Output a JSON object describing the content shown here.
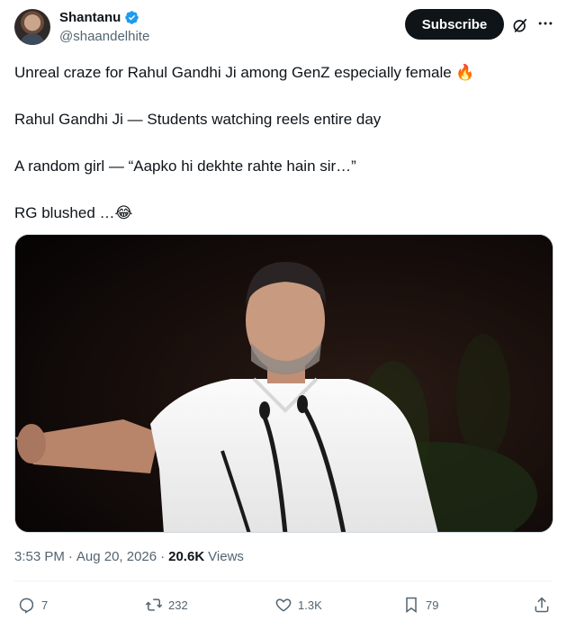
{
  "author": {
    "name": "Shantanu",
    "handle": "@shaandelhite"
  },
  "header": {
    "subscribe_label": "Subscribe"
  },
  "post": {
    "lines": [
      "Unreal craze for Rahul Gandhi Ji among GenZ especially female 🔥",
      "Rahul Gandhi Ji — Students watching reels entire day",
      "A random girl — “Aapko hi dekhte rahte hain sir…”",
      "RG blushed …😂"
    ]
  },
  "meta": {
    "time": "3:53 PM",
    "separator": "·",
    "date": "Aug 20, 2026",
    "separator2": "·",
    "views_count": "20.6K",
    "views_label": "Views"
  },
  "actions": {
    "replies": "7",
    "reposts": "232",
    "likes": "1.3K",
    "bookmarks": "79"
  },
  "icons": [
    "verified-badge-icon",
    "grok-icon",
    "more-icon",
    "reply-icon",
    "repost-icon",
    "like-icon",
    "bookmark-icon",
    "share-icon"
  ],
  "colors": {
    "text_primary": "#0f1419",
    "text_secondary": "#536471",
    "verified_blue": "#1d9bf0",
    "subscribe_bg": "#0f1419"
  }
}
